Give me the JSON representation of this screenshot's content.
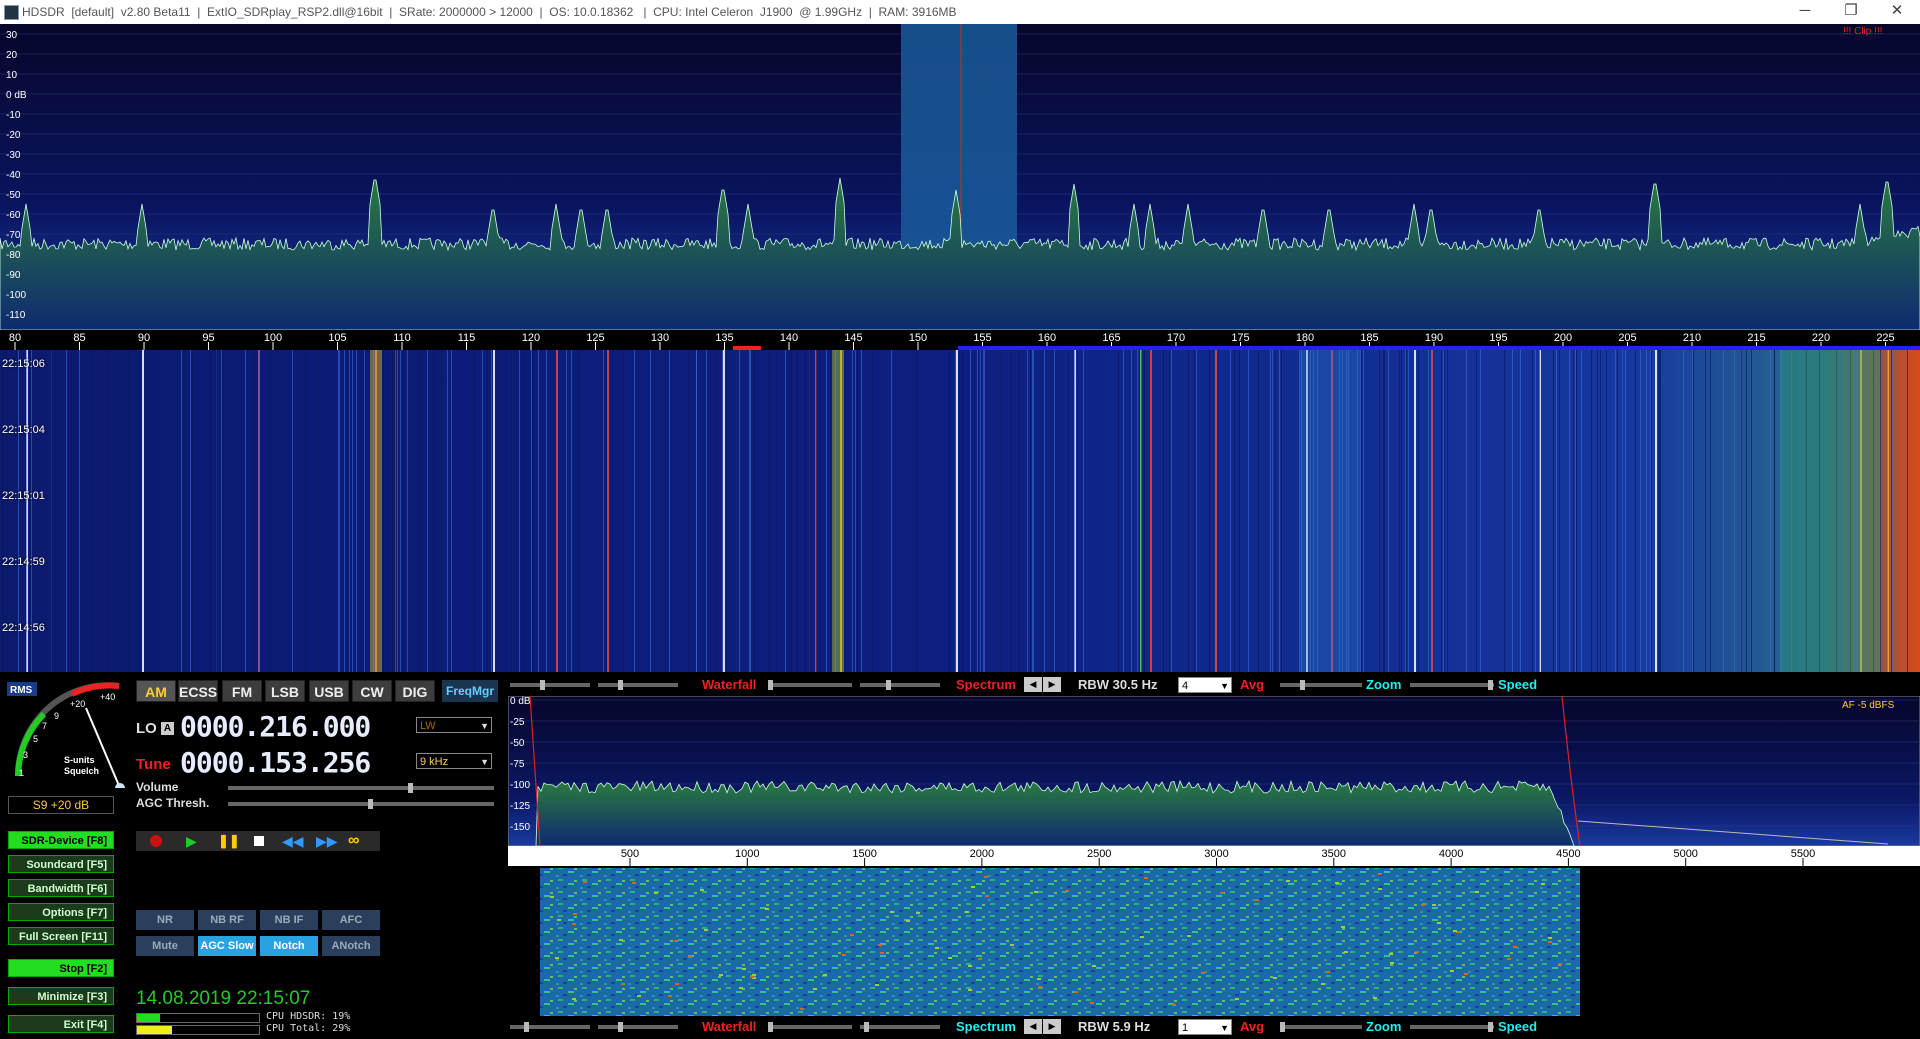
{
  "titlebar": {
    "text": "HDSDR  [default]  v2.80 Beta11  |  ExtIO_SDRplay_RSP2.dll@16bit  |  SRate: 2000000 > 12000  |  OS: 10.0.18362   |  CPU: Intel Celeron  J1900  @ 1.99GHz  |  RAM: 3916MB",
    "minimize": "─",
    "restore": "❐",
    "close": "✕"
  },
  "spectrum": {
    "db_labels": [
      "30",
      "20",
      "10",
      "0 dB",
      "-10",
      "-20",
      "-30",
      "-40",
      "-50",
      "-60",
      "-70",
      "-80",
      "-90",
      "-100",
      "-110"
    ],
    "clip": "!!! Clip !!!"
  },
  "freq_scale": {
    "labels": [
      "80",
      "85",
      "90",
      "95",
      "100",
      "105",
      "110",
      "115",
      "120",
      "125",
      "130",
      "135",
      "140",
      "145",
      "150",
      "155",
      "160",
      "165",
      "170",
      "175",
      "180",
      "185",
      "190",
      "195",
      "200",
      "205",
      "210",
      "215",
      "220",
      "225"
    ]
  },
  "waterfall": {
    "timestamps": [
      "22:15:06",
      "22:15:04",
      "22:15:01",
      "22:14:59",
      "22:14:56"
    ]
  },
  "smeter": {
    "rms": "RMS",
    "scale": [
      "1",
      "3",
      "5",
      "7",
      "9",
      "+20",
      "+40"
    ],
    "label1": "S-units",
    "label2": "Squelch",
    "reading": "S9 +20 dB"
  },
  "modes": [
    "AM",
    "ECSS",
    "FM",
    "LSB",
    "USB",
    "CW",
    "DIG"
  ],
  "active_mode": "AM",
  "freqmgr": "FreqMgr",
  "lo": {
    "label": "LO",
    "badge": "A",
    "value": "0000.216.000",
    "band": "LW"
  },
  "tune": {
    "label": "Tune",
    "value": "0000.153.256",
    "bandwidth": "9 kHz"
  },
  "volume_label": "Volume",
  "agc_label": "AGC Thresh.",
  "fkeys": [
    {
      "label": "SDR-Device [F8]",
      "style": "bright"
    },
    {
      "label": "Soundcard [F5]",
      "style": "dark"
    },
    {
      "label": "Bandwidth [F6]",
      "style": "dark"
    },
    {
      "label": "Options  [F7]",
      "style": "dark"
    },
    {
      "label": "Full Screen [F11]",
      "style": "dark"
    },
    {
      "label": "Stop      [F2]",
      "style": "bright"
    },
    {
      "label": "Minimize [F3]",
      "style": "dark"
    },
    {
      "label": "Exit      [F4]",
      "style": "dark"
    }
  ],
  "dsp_row1": [
    "NR",
    "NB RF",
    "NB IF",
    "AFC"
  ],
  "dsp_row2": [
    "Mute",
    "AGC Slow",
    "Notch",
    "ANotch"
  ],
  "dsp_row2_on": [
    false,
    true,
    true,
    false
  ],
  "datetime": "14.08.2019 22:15:07",
  "cpu": {
    "hdsdr": "CPU HDSDR: 19%",
    "total": "CPU Total: 29%",
    "hdsdr_pct": 19,
    "total_pct": 29
  },
  "rf_controls": {
    "waterfall": "Waterfall",
    "spectrum": "Spectrum",
    "rbw": "RBW 30.5 Hz",
    "avg_value": "4",
    "avg": "Avg",
    "zoom": "Zoom",
    "speed": "Speed"
  },
  "af_controls": {
    "waterfall": "Waterfall",
    "spectrum": "Spectrum",
    "rbw": "RBW  5.9 Hz",
    "avg_value": "1",
    "avg": "Avg",
    "zoom": "Zoom",
    "speed": "Speed"
  },
  "af_spectrum": {
    "db_labels": [
      "0 dB",
      "-25",
      "-50",
      "-75",
      "-100",
      "-125",
      "-150"
    ],
    "level": "AF  -5 dBFS",
    "freq_labels": [
      "500",
      "1000",
      "1500",
      "2000",
      "2500",
      "3000",
      "3500",
      "4000",
      "4500",
      "5000",
      "5500"
    ]
  },
  "colors": {
    "accent_green": "#22dd22",
    "clip_red": "#ff2222",
    "spectrum_bg": "#0a1060",
    "passband": "#1a5a9a"
  }
}
